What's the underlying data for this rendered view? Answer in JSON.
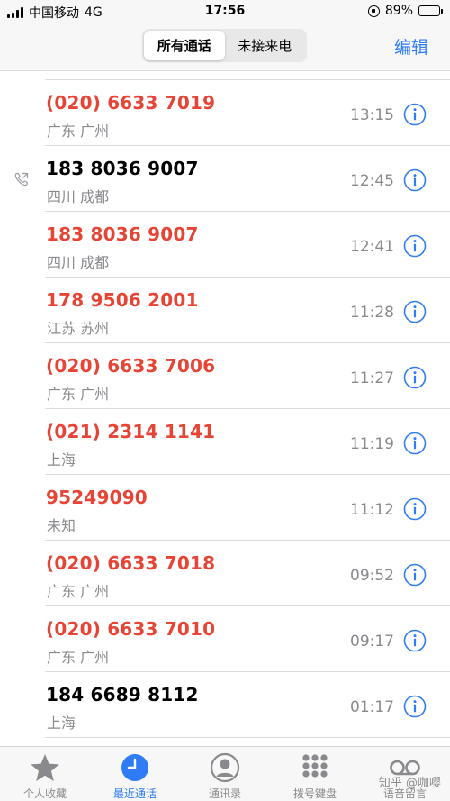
{
  "status_bar": {
    "carrier": "中国移动",
    "network": "4G",
    "time": "17:56",
    "battery": "89%",
    "battery_level": 0.89,
    "battery_color": "#4cd964"
  },
  "nav": {
    "segments": [
      "所有通话",
      "未接来电"
    ],
    "active_segment": "所有通话",
    "edit_label": "编辑",
    "accent_color": "#2f7cf6"
  },
  "calls": [
    {
      "number": "(020) 6633 7019",
      "location": "广东 广州",
      "time": "13:15",
      "missed": true,
      "outgoing": false
    },
    {
      "number": "183 8036 9007",
      "location": "四川 成都",
      "time": "12:45",
      "missed": false,
      "outgoing": true
    },
    {
      "number": "183 8036 9007",
      "location": "四川 成都",
      "time": "12:41",
      "missed": true,
      "outgoing": false
    },
    {
      "number": "178 9506 2001",
      "location": "江苏 苏州",
      "time": "11:28",
      "missed": true,
      "outgoing": false
    },
    {
      "number": "(020) 6633 7006",
      "location": "广东 广州",
      "time": "11:27",
      "missed": true,
      "outgoing": false
    },
    {
      "number": "(021) 2314 1141",
      "location": "上海",
      "time": "11:19",
      "missed": true,
      "outgoing": false
    },
    {
      "number": "95249090",
      "location": "未知",
      "time": "11:12",
      "missed": true,
      "outgoing": false
    },
    {
      "number": "(020) 6633 7018",
      "location": "广东 广州",
      "time": "09:52",
      "missed": true,
      "outgoing": false
    },
    {
      "number": "(020) 6633 7010",
      "location": "广东 广州",
      "time": "09:17",
      "missed": true,
      "outgoing": false
    },
    {
      "number": "184 6689 8112",
      "location": "上海",
      "time": "01:17",
      "missed": false,
      "outgoing": false
    }
  ],
  "missed_color": "#e64536",
  "tabs": [
    {
      "label": "个人收藏",
      "icon": "star-icon",
      "active": false
    },
    {
      "label": "最近通话",
      "icon": "clock-icon",
      "active": true
    },
    {
      "label": "通讯录",
      "icon": "contacts-icon",
      "active": false
    },
    {
      "label": "拨号键盘",
      "icon": "keypad-icon",
      "active": false
    },
    {
      "label": "语音留言",
      "icon": "voicemail-icon",
      "active": false
    }
  ],
  "watermark": "知乎 @咖嘤"
}
